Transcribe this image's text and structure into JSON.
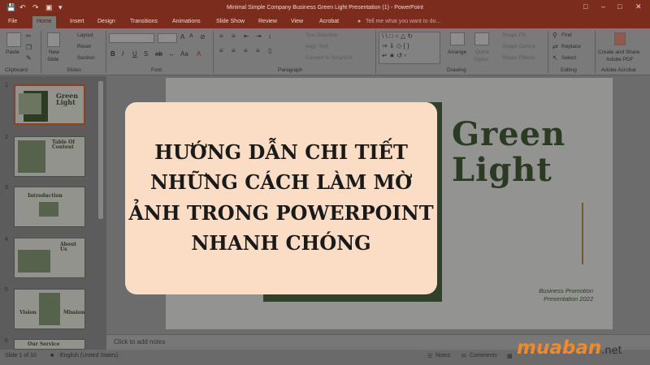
{
  "window": {
    "title": "Minimal Simple Company Business Green Light Presentation (1) - PowerPoint"
  },
  "tabs": [
    "File",
    "Home",
    "Insert",
    "Design",
    "Transitions",
    "Animations",
    "Slide Show",
    "Review",
    "View",
    "Acrobat"
  ],
  "tell_me": "Tell me what you want to do...",
  "ribbon": {
    "clipboard": {
      "paste": "Paste",
      "group": "Clipboard"
    },
    "slides": {
      "new_slide_1": "New",
      "new_slide_2": "Slide",
      "layout": "Layout",
      "reset": "Reset",
      "section": "Section",
      "group": "Slides"
    },
    "font": {
      "group": "Font"
    },
    "paragraph": {
      "text_direction": "Text Direction",
      "align_text": "Align Text",
      "convert_smartart": "Convert to SmartArt",
      "group": "Paragraph"
    },
    "drawing": {
      "arrange": "Arrange",
      "quick_styles_1": "Quick",
      "quick_styles_2": "Styles",
      "shape_fill": "Shape Fill",
      "shape_outline": "Shape Outline",
      "shape_effects": "Shape Effects",
      "group": "Drawing"
    },
    "editing": {
      "find": "Find",
      "replace": "Replace",
      "select": "Select",
      "group": "Editing"
    },
    "acrobat": {
      "create_1": "Create and Share",
      "create_2": "Adobe PDF",
      "group": "Adobe Acrobat"
    }
  },
  "thumbnails": [
    {
      "number": "1",
      "text": "Green Light"
    },
    {
      "number": "2",
      "text": "Table Of Content"
    },
    {
      "number": "3",
      "text": "Introduction"
    },
    {
      "number": "4",
      "text": "About Us"
    },
    {
      "number": "5",
      "text_a": "Vision",
      "text_b": "Mission"
    },
    {
      "number": "6",
      "text": "Our Service"
    }
  ],
  "slide": {
    "title_line1": "Green",
    "title_line2": "Light",
    "subtitle_line1": "Business Promotion",
    "subtitle_line2": "Presentation 2022"
  },
  "notes_placeholder": "Click to add notes",
  "status": {
    "slide_counter": "Slide 1 of 10",
    "language": "English (United States)",
    "notes": "Notes",
    "comments": "Comments"
  },
  "overlay": {
    "line1": "HƯỚNG DẪN CHI TIẾT",
    "line2": "NHỮNG CÁCH LÀM MỜ",
    "line3": "ẢNH TRONG POWERPOINT",
    "line4": "NHANH CHÓNG"
  },
  "watermark": {
    "brand": "muaban",
    "suffix": ".net"
  },
  "colors": {
    "titlebar": "#7c2c1c",
    "slide_green": "#2b3a22",
    "overlay_card": "#fbdcc4",
    "watermark_orange": "#ef8a2b"
  }
}
